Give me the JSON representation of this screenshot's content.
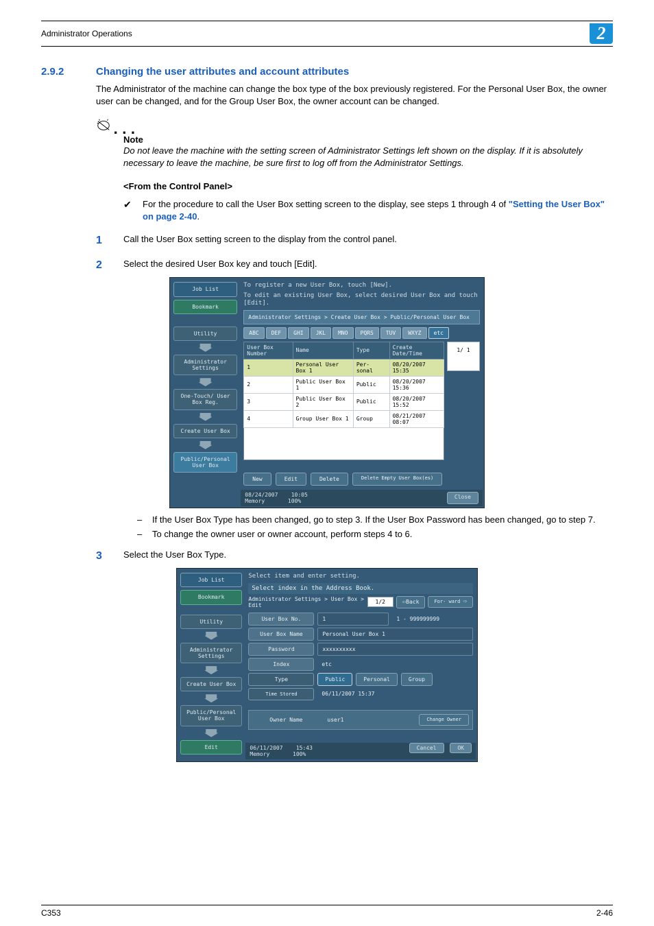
{
  "header": {
    "title": "Administrator Operations",
    "badge": "2"
  },
  "section": {
    "number": "2.9.2",
    "title": "Changing the user attributes and account attributes",
    "intro": "The Administrator of the machine can change the box type of the box previously registered. For the Personal User Box, the owner user can be changed, and for the Group User Box, the owner account can be changed."
  },
  "note": {
    "label": "Note",
    "body": "Do not leave the machine with the setting screen of Administrator Settings left shown on the display. If it is absolutely necessary to leave the machine, be sure first to log off from the Administrator Settings."
  },
  "panel_title": "<From the Control Panel>",
  "check_prefix": "For the procedure to call the User Box setting screen to the display, see steps 1 through 4 of ",
  "check_link": "\"Setting the User Box\" on page 2-40",
  "check_suffix": ".",
  "steps": {
    "s1": "Call the User Box setting screen to the display from the control panel.",
    "s2": "Select the desired User Box key and touch [Edit].",
    "s2b1": "If the User Box Type has been changed, go to step 3. If the User Box Password has been changed, go to step 7.",
    "s2b2": "To change the owner user or owner account, perform steps 4 to 6.",
    "s3": "Select the User Box Type."
  },
  "ss1": {
    "sidebar": [
      "Job List",
      "Bookmark",
      "Utility",
      "Administrator Settings",
      "One-Touch/ User Box Reg.",
      "Create User Box",
      "Public/Personal User Box"
    ],
    "hdr1": "To register a new User Box, touch [New].",
    "hdr2": "To edit an existing User Box, select desired User Box and touch [Edit].",
    "path": "Administrator Settings > Create User Box > Public/Personal User Box",
    "tabs": [
      "ABC",
      "DEF",
      "GHI",
      "JKL",
      "MNO",
      "PQRS",
      "TUV",
      "WXYZ",
      "etc"
    ],
    "cols": [
      "User Box Number",
      "Name",
      "Type",
      "Create Date/Time"
    ],
    "rows": [
      {
        "n": "1",
        "name": "Personal User Box 1",
        "type": "Per- sonal",
        "dt": "08/20/2007 15:35",
        "hl": true
      },
      {
        "n": "2",
        "name": "Public User Box 1",
        "type": "Public",
        "dt": "08/20/2007 15:36"
      },
      {
        "n": "3",
        "name": "Public User Box 2",
        "type": "Public",
        "dt": "08/20/2007 15:52"
      },
      {
        "n": "4",
        "name": "Group User Box 1",
        "type": "Group",
        "dt": "08/21/2007 08:07"
      }
    ],
    "pageind": "1/  1",
    "actions": [
      "New",
      "Edit",
      "Delete",
      "Delete Empty User Box(es)"
    ],
    "status_date": "08/24/2007",
    "status_time": "10:05",
    "status_mem": "Memory",
    "status_pct": "100%",
    "close": "Close"
  },
  "ss2": {
    "sidebar": [
      "Job List",
      "Bookmark",
      "Utility",
      "Administrator Settings",
      "Create User Box",
      "Public/Personal User Box",
      "Edit"
    ],
    "hdr1": "Select item and enter setting.",
    "hdr2": "Select index in the Address Book.",
    "path": "Administrator Settings > User Box > Edit",
    "nav_page": "1/2",
    "nav_back": "Back",
    "nav_fwd": "For- ward",
    "fields": {
      "no_label": "User Box No.",
      "no_val": "1",
      "no_range": "1 - 999999999",
      "name_label": "User Box Name",
      "name_val": "Personal User Box 1",
      "pwd_label": "Password",
      "pwd_val": "xxxxxxxxxx",
      "idx_label": "Index",
      "idx_val": "etc",
      "type_label": "Type",
      "type_opts": [
        "Public",
        "Personal",
        "Group"
      ],
      "time_label": "Time Stored",
      "time_val": "06/11/2007  15:37",
      "owner_label": "Owner Name",
      "owner_val": "user1",
      "change_owner": "Change Owner"
    },
    "status_date": "06/11/2007",
    "status_time": "15:43",
    "status_mem": "Memory",
    "status_pct": "100%",
    "cancel": "Cancel",
    "ok": "OK"
  },
  "footer": {
    "left": "C353",
    "right": "2-46"
  }
}
